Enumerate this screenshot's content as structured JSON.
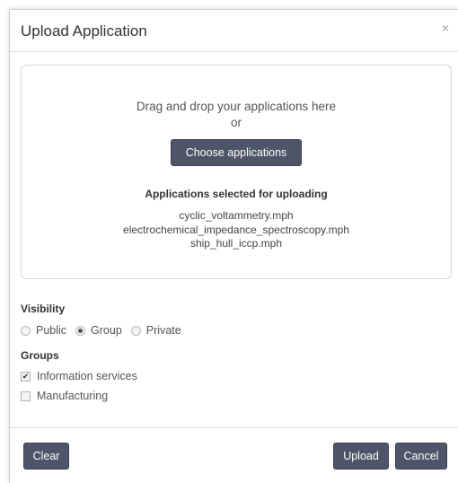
{
  "dialog": {
    "title": "Upload Application",
    "close_label": "×"
  },
  "dropzone": {
    "line1": "Drag and drop your applications here",
    "line2": "or",
    "choose_label": "Choose applications",
    "selected_heading": "Applications selected for uploading",
    "files": [
      "cyclic_voltammetry.mph",
      "electrochemical_impedance_spectroscopy.mph",
      "ship_hull_iccp.mph"
    ]
  },
  "visibility": {
    "label": "Visibility",
    "options": [
      {
        "label": "Public",
        "checked": false
      },
      {
        "label": "Group",
        "checked": true
      },
      {
        "label": "Private",
        "checked": false
      }
    ]
  },
  "groups": {
    "label": "Groups",
    "items": [
      {
        "label": "Information services",
        "checked": true
      },
      {
        "label": "Manufacturing",
        "checked": false
      }
    ]
  },
  "footer": {
    "clear_label": "Clear",
    "upload_label": "Upload",
    "cancel_label": "Cancel"
  },
  "colors": {
    "button_bg": "#4e5568",
    "button_text": "#ffffff"
  }
}
